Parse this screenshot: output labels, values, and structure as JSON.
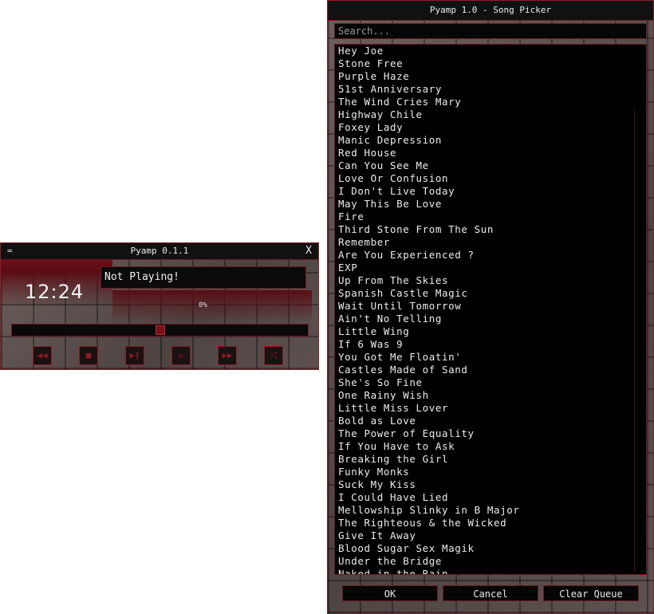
{
  "player": {
    "menu_glyph": "=",
    "title": "Pyamp 0.1.1",
    "close_glyph": "X",
    "time": "12:24",
    "status": "Not Playing!",
    "percent_label": "0%",
    "progress_fraction": 0.5,
    "controls": [
      {
        "name": "rewind-icon",
        "glyph": "◀◀"
      },
      {
        "name": "stop-icon",
        "glyph": "■"
      },
      {
        "name": "play-pause-icon",
        "glyph": "▶❙"
      },
      {
        "name": "repeat-icon",
        "glyph": "↻"
      },
      {
        "name": "fast-forward-icon",
        "glyph": "▶▶"
      },
      {
        "name": "shuffle-icon",
        "glyph": "⤮"
      }
    ]
  },
  "picker": {
    "title": "Pyamp 1.0 - Song Picker",
    "search_placeholder": "Search...",
    "songs": [
      "Hey Joe",
      "Stone Free",
      "Purple Haze",
      "51st Anniversary",
      "The Wind Cries Mary",
      "Highway Chile",
      "Foxey Lady",
      "Manic Depression",
      "Red House",
      "Can You See Me",
      "Love Or Confusion",
      "I Don't Live Today",
      "May This Be Love",
      "Fire",
      "Third Stone From The Sun",
      "Remember",
      "Are You Experienced ?",
      "EXP",
      "Up From The Skies",
      "Spanish Castle Magic",
      "Wait Until Tomorrow",
      "Ain't No Telling",
      "Little Wing",
      "If 6 Was 9",
      "You Got Me Floatin'",
      "Castles Made of Sand",
      "She's So Fine",
      "One Rainy Wish",
      "Little Miss Lover",
      "Bold as Love",
      "The Power of Equality",
      "If You Have to Ask",
      "Breaking the Girl",
      "Funky Monks",
      "Suck My Kiss",
      "I Could Have Lied",
      "Mellowship Slinky in B Major",
      "The Righteous & the Wicked",
      "Give It Away",
      "Blood Sugar Sex Magik",
      "Under the Bridge",
      "Naked in the Rain"
    ],
    "ok_label": "OK",
    "cancel_label": "Cancel",
    "clear_label": "Clear Queue"
  },
  "colors": {
    "accent": "#8a1f2a",
    "background": "#000000",
    "text": "#e6e6e6"
  }
}
